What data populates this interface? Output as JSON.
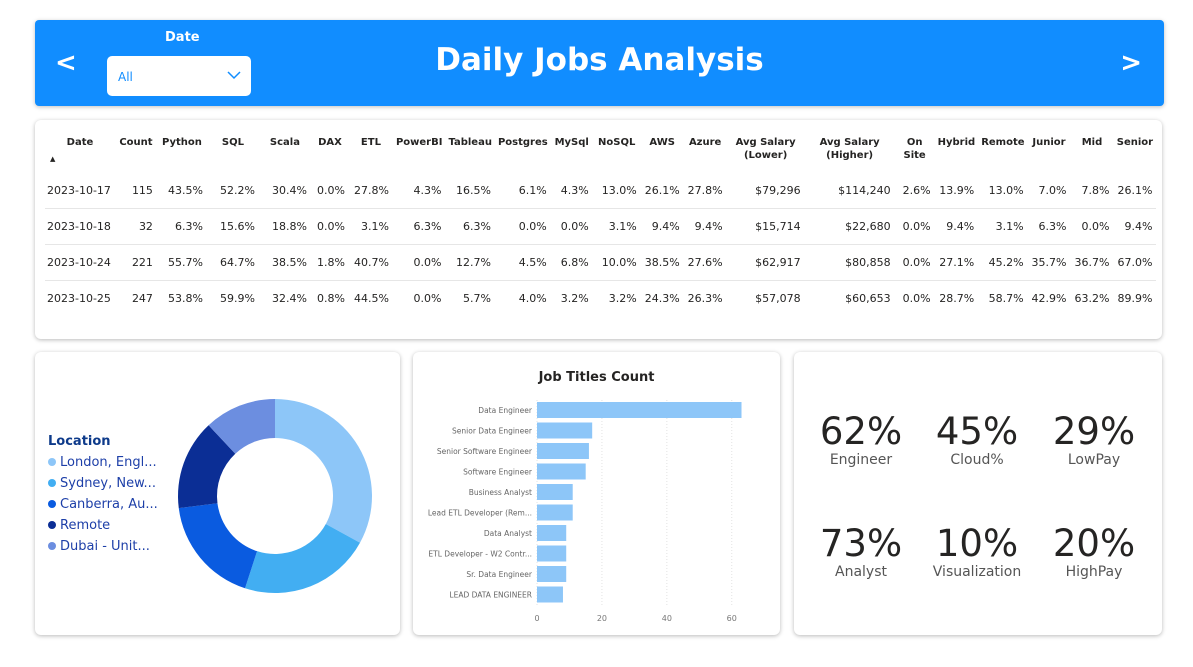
{
  "header": {
    "title": "Daily Jobs Analysis",
    "prev_label": "<",
    "next_label": ">",
    "date_filter": {
      "label": "Date",
      "value": "All"
    }
  },
  "table": {
    "columns": [
      "Date",
      "Count",
      "Python",
      "SQL",
      "Scala",
      "DAX",
      "ETL",
      "PowerBI",
      "Tableau",
      "Postgres",
      "MySql",
      "NoSQL",
      "AWS",
      "Azure",
      "Avg Salary (Lower)",
      "Avg Salary (Higher)",
      "On Site",
      "Hybrid",
      "Remote",
      "Junior",
      "Mid",
      "Senior"
    ],
    "rows": [
      [
        "2023-10-17",
        "115",
        "43.5%",
        "52.2%",
        "30.4%",
        "0.0%",
        "27.8%",
        "4.3%",
        "16.5%",
        "6.1%",
        "4.3%",
        "13.0%",
        "26.1%",
        "27.8%",
        "$79,296",
        "$114,240",
        "2.6%",
        "13.9%",
        "13.0%",
        "7.0%",
        "7.8%",
        "26.1%"
      ],
      [
        "2023-10-18",
        "32",
        "6.3%",
        "15.6%",
        "18.8%",
        "0.0%",
        "3.1%",
        "6.3%",
        "6.3%",
        "0.0%",
        "0.0%",
        "3.1%",
        "9.4%",
        "9.4%",
        "$15,714",
        "$22,680",
        "0.0%",
        "9.4%",
        "3.1%",
        "6.3%",
        "0.0%",
        "9.4%"
      ],
      [
        "2023-10-24",
        "221",
        "55.7%",
        "64.7%",
        "38.5%",
        "1.8%",
        "40.7%",
        "0.0%",
        "12.7%",
        "4.5%",
        "6.8%",
        "10.0%",
        "38.5%",
        "27.6%",
        "$62,917",
        "$80,858",
        "0.0%",
        "27.1%",
        "45.2%",
        "35.7%",
        "36.7%",
        "67.0%"
      ],
      [
        "2023-10-25",
        "247",
        "53.8%",
        "59.9%",
        "32.4%",
        "0.8%",
        "44.5%",
        "0.0%",
        "5.7%",
        "4.0%",
        "3.2%",
        "3.2%",
        "24.3%",
        "26.3%",
        "$57,078",
        "$60,653",
        "0.0%",
        "28.7%",
        "58.7%",
        "42.9%",
        "63.2%",
        "89.9%"
      ]
    ]
  },
  "location": {
    "legend_title": "Location",
    "items": [
      {
        "label": "London, Engl...",
        "color": "#8DC6F8",
        "share": 0.33
      },
      {
        "label": "Sydney, New...",
        "color": "#42AEF2",
        "share": 0.22
      },
      {
        "label": "Canberra, Au...",
        "color": "#0A5BE0",
        "share": 0.18
      },
      {
        "label": "Remote",
        "color": "#0B2E95",
        "share": 0.15
      },
      {
        "label": "Dubai - Unit...",
        "color": "#6C8EE0",
        "share": 0.12
      }
    ]
  },
  "chart_data": {
    "type": "bar",
    "orientation": "horizontal",
    "title": "Job Titles Count",
    "categories": [
      "Data Engineer",
      "Senior Data Engineer",
      "Senior Software Engineer",
      "Software Engineer",
      "Business Analyst",
      "Lead ETL Developer (Rem...",
      "Data Analyst",
      "ETL Developer - W2 Contr...",
      "Sr. Data Engineer",
      "LEAD DATA ENGINEER"
    ],
    "values": [
      63,
      17,
      16,
      15,
      11,
      11,
      9,
      9,
      9,
      8
    ],
    "xticks": [
      0,
      20,
      40,
      60
    ],
    "xlim": [
      0,
      65
    ],
    "grid": true,
    "color": "#8DC6F8"
  },
  "kpis": [
    {
      "value": "62%",
      "label": "Engineer"
    },
    {
      "value": "45%",
      "label": "Cloud%"
    },
    {
      "value": "29%",
      "label": "LowPay"
    },
    {
      "value": "73%",
      "label": "Analyst"
    },
    {
      "value": "10%",
      "label": "Visualization"
    },
    {
      "value": "20%",
      "label": "HighPay"
    }
  ],
  "colors": {
    "accent": "#118DFF"
  }
}
